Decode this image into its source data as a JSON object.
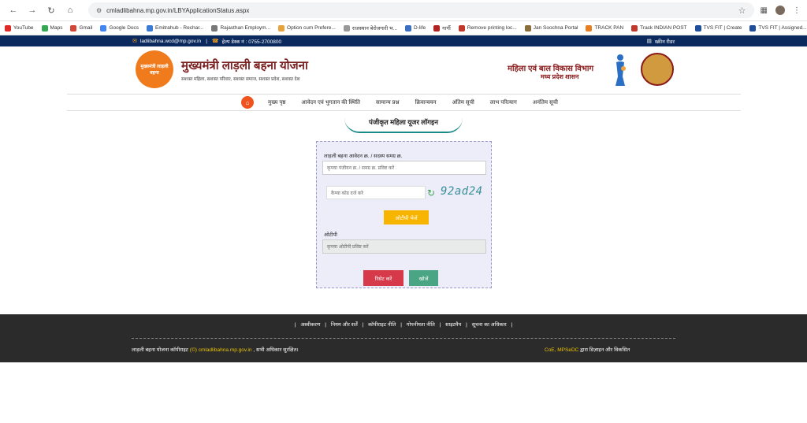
{
  "browser": {
    "url": "cmladlibahna.mp.gov.in/LBYApplicationStatus.aspx",
    "bookmarks": [
      {
        "label": "YouTube",
        "color": "#e02a2a"
      },
      {
        "label": "Maps",
        "color": "#34a853"
      },
      {
        "label": "Gmail",
        "color": "#d44638"
      },
      {
        "label": "Google Docs",
        "color": "#4285f4"
      },
      {
        "label": "Emitrahub - Rechar...",
        "color": "#3a7bd5"
      },
      {
        "label": "Rajasthan Employm...",
        "color": "#777777"
      },
      {
        "label": "Option cum Prefere...",
        "color": "#e8a23c"
      },
      {
        "label": "राजस्थान बेरोजगारी भ...",
        "color": "#999999"
      },
      {
        "label": "D-life",
        "color": "#3a6fc4"
      },
      {
        "label": "गार्गी",
        "color": "#b22222"
      },
      {
        "label": "Remove printing loc...",
        "color": "#c0392b"
      },
      {
        "label": "Jan Soochna Portal",
        "color": "#8a6d3b"
      },
      {
        "label": "TRACK PAN",
        "color": "#e67e22"
      },
      {
        "label": "Track INDIAN POST",
        "color": "#c0392b"
      },
      {
        "label": "TVS FIT | Create",
        "color": "#1f4e9c"
      },
      {
        "label": "TVS FIT | Assigned...",
        "color": "#1f4e9c"
      }
    ]
  },
  "topbar": {
    "email": "ladlibahna.wcd@mp.gov.in",
    "helpdesk": "हेल्प डेस्क नं : 0755-2700800",
    "screen_reader": "स्क्रीन रीडर"
  },
  "header": {
    "logo_text": "मुख्यमंत्री लाड़ली बहना",
    "title": "मुख्यमंत्री लाड़ली बहना योजना",
    "tagline": "सशक्त महिला, सशक्त परिवार, सशक्त समाज, सशक्त प्रदेश, सशक्त देश",
    "dept_title": "महिला एवं बाल विकास विभाग",
    "dept_sub": "मध्य प्रदेश शासन"
  },
  "menu": {
    "items": [
      "मुख्य पृष्ठ",
      "आवेदन एवं भुगतान की स्थिति",
      "सामान्य प्रश्न",
      "क्रियान्वयन",
      "अंतिम सूची",
      "लाभ परित्याग",
      "अनंतिम सूची"
    ]
  },
  "login": {
    "heading": "पंजीकृत महिला यूजर लॉगइन",
    "app_label": "लाड़ली बहना आवेदन क्र. / सदस्य समग्र क्र.",
    "app_placeholder": "कृपया पंजीयन क्र. / समग्र क्र. प्रविष्ट करें",
    "captcha_placeholder": "कैप्चा कोड दर्ज करे",
    "captcha_code": "92ad24",
    "otp_button": "ओटीपी भेजें",
    "otp_label": "ओटीपी",
    "otp_placeholder": "कृपया ओटीपी प्रविष्ट करें",
    "reset_button": "रिसेट करें",
    "search_button": "खोजें"
  },
  "footer": {
    "links": [
      "अस्वीकरण",
      "नियम और शर्तें",
      "कॉपीराइट नीति",
      "गोपनीयता नीति",
      "साइटमैप",
      "सूचना का अधिकार"
    ],
    "copy_prefix": "लाड़ली बहना योजना कॉपीराइट",
    "copy_highlight": "(©) cmladlibahna.mp.gov.in",
    "copy_suffix": ", सभी अधिकार सुरक्षित।",
    "credit_highlight": "CoE, MPSeDC",
    "credit_suffix": "द्वारा डिज़ाइन और विकसित"
  }
}
